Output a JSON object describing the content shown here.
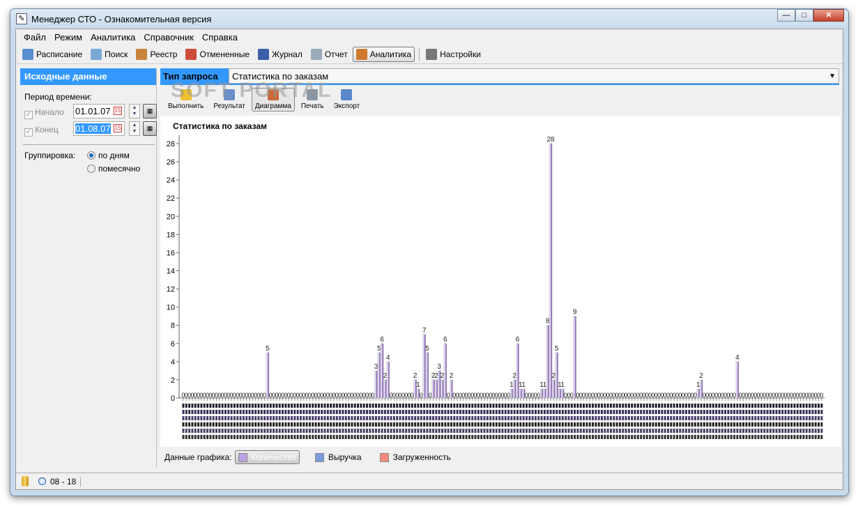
{
  "window": {
    "title": "Менеджер СТО - Ознакомительная версия",
    "controls": [
      "minimize",
      "maximize",
      "close"
    ]
  },
  "menu": [
    "Файл",
    "Режим",
    "Аналитика",
    "Справочник",
    "Справка"
  ],
  "toolbar": [
    {
      "label": "Расписание",
      "icon": "calendar-grid-icon",
      "color": "#5b8fd0"
    },
    {
      "label": "Поиск",
      "icon": "search-icon",
      "color": "#7aa9d6"
    },
    {
      "label": "Реестр",
      "icon": "clipboard-check-icon",
      "color": "#c8843a"
    },
    {
      "label": "Отмененные",
      "icon": "cancelled-icon",
      "color": "#d04a3a"
    },
    {
      "label": "Журнал",
      "icon": "journal-icon",
      "color": "#3b5fa8"
    },
    {
      "label": "Отчет",
      "icon": "report-icon",
      "color": "#9aaabb"
    },
    {
      "label": "Аналитика",
      "icon": "bar-chart-icon",
      "color": "#d07a30",
      "active": true
    },
    {
      "label": "Настройки",
      "icon": "tools-icon",
      "color": "#777777"
    }
  ],
  "left": {
    "header": "Исходные данные",
    "period_label": "Период времени:",
    "start": {
      "label": "Начало",
      "checked": true,
      "value": "01.01.07"
    },
    "end": {
      "label": "Конец",
      "checked": true,
      "value": "01.08.07"
    },
    "calendar_day": "15",
    "grouping_label": "Группировка:",
    "grouping_options": [
      {
        "label": "по дням",
        "selected": true
      },
      {
        "label": "помесячно",
        "selected": false
      }
    ]
  },
  "query": {
    "label": "Тип запроса",
    "value": "Статистика по заказам"
  },
  "actions": [
    {
      "label": "Выполнить",
      "icon": "lightning-icon"
    },
    {
      "label": "Результат",
      "icon": "table-icon"
    },
    {
      "label": "Диаграмма",
      "icon": "chart-icon",
      "active": true
    },
    {
      "label": "Печать",
      "icon": "printer-icon"
    },
    {
      "label": "Экспорт",
      "icon": "export-icon"
    }
  ],
  "watermark": "SOFTPORTAL www.softportal.com",
  "chart_data": {
    "type": "bar",
    "title": "Статистика по заказам",
    "ylim": [
      0,
      28
    ],
    "yticks": [
      0,
      2,
      4,
      6,
      8,
      10,
      12,
      14,
      16,
      18,
      20,
      22,
      24,
      26,
      28
    ],
    "grid": false,
    "bar_color": "#5a2d91",
    "values": [
      0,
      0,
      0,
      0,
      0,
      0,
      0,
      0,
      0,
      0,
      0,
      0,
      0,
      0,
      0,
      0,
      0,
      0,
      0,
      0,
      0,
      0,
      0,
      0,
      0,
      0,
      0,
      0,
      5,
      0,
      0,
      0,
      0,
      0,
      0,
      0,
      0,
      0,
      0,
      0,
      0,
      0,
      0,
      0,
      0,
      0,
      0,
      0,
      0,
      0,
      0,
      0,
      0,
      0,
      0,
      0,
      0,
      0,
      0,
      0,
      0,
      0,
      0,
      0,
      3,
      5,
      6,
      2,
      4,
      0,
      0,
      0,
      0,
      0,
      0,
      0,
      0,
      2,
      1,
      0,
      7,
      5,
      0,
      2,
      2,
      3,
      2,
      6,
      0,
      2,
      0,
      0,
      0,
      0,
      0,
      0,
      0,
      0,
      0,
      0,
      0,
      0,
      0,
      0,
      0,
      0,
      0,
      0,
      0,
      1,
      2,
      6,
      1,
      1,
      0,
      0,
      0,
      0,
      0,
      1,
      1,
      8,
      28,
      2,
      5,
      1,
      1,
      0,
      0,
      0,
      9,
      0,
      0,
      0,
      0,
      0,
      0,
      0,
      0,
      0,
      0,
      0,
      0,
      0,
      0,
      0,
      0,
      0,
      0,
      0,
      0,
      0,
      0,
      0,
      0,
      0,
      0,
      0,
      0,
      0,
      0,
      0,
      0,
      0,
      0,
      0,
      0,
      0,
      0,
      0,
      0,
      1,
      2,
      0,
      0,
      0,
      0,
      0,
      0,
      0,
      0,
      0,
      0,
      0,
      4,
      0,
      0,
      0,
      0,
      0,
      0,
      0,
      0,
      0,
      0,
      0,
      0,
      0,
      0,
      0,
      0,
      0,
      0,
      0,
      0,
      0,
      0,
      0,
      0,
      0,
      0,
      0,
      0
    ]
  },
  "legend": {
    "label": "Данные графика:",
    "items": [
      {
        "label": "Количество",
        "color": "#b9a3df",
        "active": true
      },
      {
        "label": "Выручка",
        "color": "#7b9be0",
        "active": false
      },
      {
        "label": "Загруженность",
        "color": "#f28b7e",
        "active": false
      }
    ]
  },
  "status": {
    "time": "08 - 18"
  }
}
